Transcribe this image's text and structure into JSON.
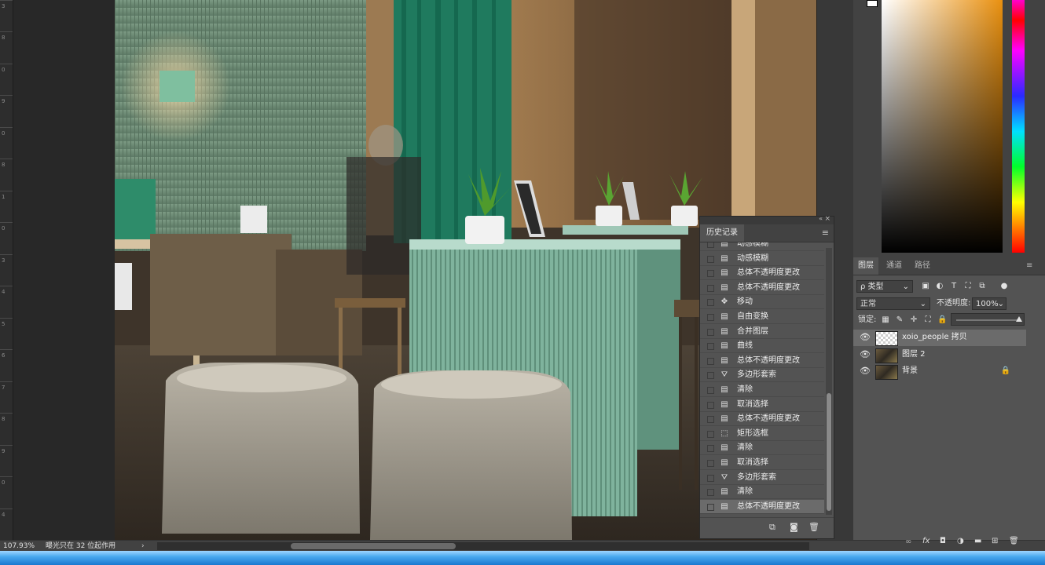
{
  "status": {
    "zoom": "107.93%",
    "message": "曝光只在 32 位起作用",
    "arrow": "›"
  },
  "ruler": {
    "labels": [
      "3",
      "8",
      "0",
      "9",
      "0",
      "8",
      "1",
      "0",
      "3",
      "4",
      "5",
      "6",
      "7",
      "8",
      "9",
      "0",
      "4"
    ]
  },
  "colors": {
    "panel_dark": "#424242",
    "panel_mid": "#535353",
    "selection": "#6b6b6b",
    "teal": "#6fa892",
    "accent_orange": "#e9900f"
  },
  "history": {
    "title": "历史记录",
    "menu_icon": "panel-menu-icon",
    "items": [
      {
        "label": "动感模糊",
        "icon": "document-icon"
      },
      {
        "label": "动感模糊",
        "icon": "document-icon"
      },
      {
        "label": "总体不透明度更改",
        "icon": "document-icon"
      },
      {
        "label": "总体不透明度更改",
        "icon": "document-icon"
      },
      {
        "label": "移动",
        "icon": "move-icon"
      },
      {
        "label": "自由变换",
        "icon": "document-icon"
      },
      {
        "label": "合并图层",
        "icon": "document-icon"
      },
      {
        "label": "曲线",
        "icon": "document-icon"
      },
      {
        "label": "总体不透明度更改",
        "icon": "document-icon"
      },
      {
        "label": "多边形套索",
        "icon": "lasso-icon"
      },
      {
        "label": "清除",
        "icon": "document-icon"
      },
      {
        "label": "取消选择",
        "icon": "document-icon"
      },
      {
        "label": "总体不透明度更改",
        "icon": "document-icon"
      },
      {
        "label": "矩形选框",
        "icon": "marquee-icon"
      },
      {
        "label": "清除",
        "icon": "document-icon"
      },
      {
        "label": "取消选择",
        "icon": "document-icon"
      },
      {
        "label": "多边形套索",
        "icon": "lasso-icon"
      },
      {
        "label": "清除",
        "icon": "document-icon"
      },
      {
        "label": "总体不透明度更改",
        "icon": "document-icon"
      }
    ],
    "footer_icons": [
      "new-document-from-state-icon",
      "snapshot-camera-icon",
      "trash-icon"
    ]
  },
  "layers": {
    "tabs": [
      "图层",
      "通道",
      "路径"
    ],
    "filter_label": "ρ 类型",
    "blend_mode": "正常",
    "opacity_label": "不透明度:",
    "opacity_value": "100%",
    "lock_label": "锁定:",
    "items": [
      {
        "name": "xoio_people 拷贝",
        "thumb": "transparent",
        "selected": true,
        "locked": false
      },
      {
        "name": "图层 2",
        "thumb": "photo",
        "selected": false,
        "locked": false
      },
      {
        "name": "背景",
        "thumb": "photo",
        "selected": false,
        "locked": true
      }
    ],
    "footer_icons": [
      "link-icon",
      "fx-icon",
      "mask-icon",
      "adjustment-icon",
      "group-folder-icon",
      "new-layer-icon",
      "trash-icon"
    ]
  }
}
